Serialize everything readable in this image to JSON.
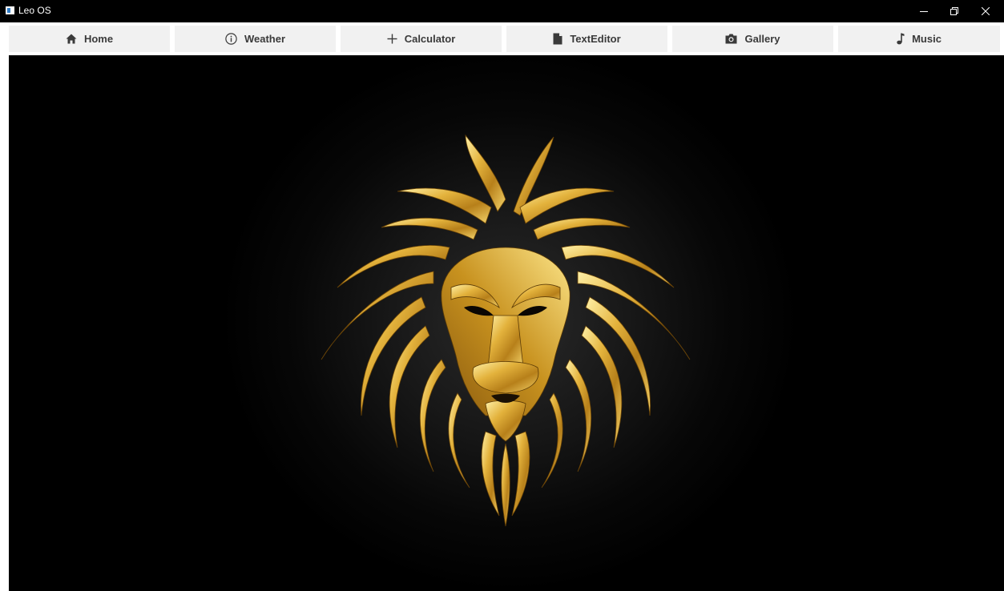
{
  "window": {
    "title": "Leo OS",
    "controls": [
      "minimize-icon",
      "restore-icon",
      "close-icon"
    ]
  },
  "tabs": [
    {
      "label": "Home",
      "icon": "home-icon"
    },
    {
      "label": "Weather",
      "icon": "info-icon"
    },
    {
      "label": "Calculator",
      "icon": "plus-icon"
    },
    {
      "label": "TextEditor",
      "icon": "document-icon"
    },
    {
      "label": "Gallery",
      "icon": "camera-icon"
    },
    {
      "label": "Music",
      "icon": "music-note-icon"
    }
  ],
  "content": {
    "image": "golden-lion-emblem",
    "background_color": "#000000",
    "accent_color": "#d4a72c"
  }
}
